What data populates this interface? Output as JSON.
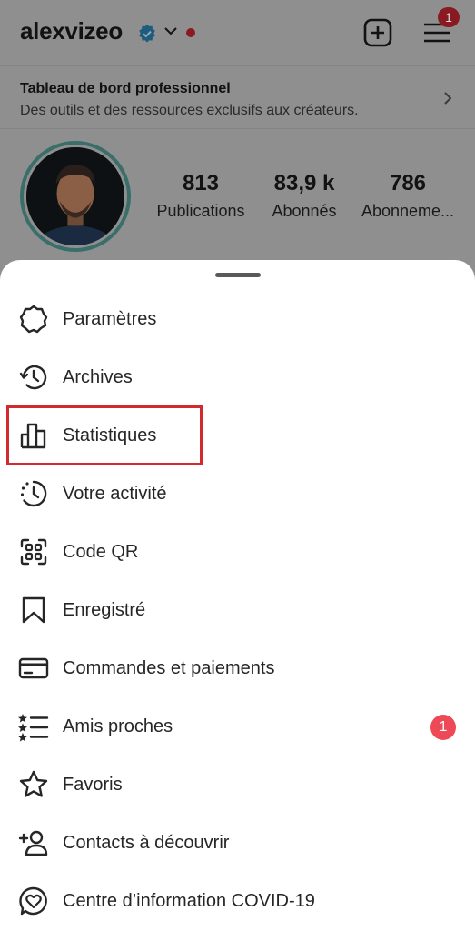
{
  "header": {
    "username": "alexvizeo",
    "menu_badge_count": "1"
  },
  "dashboard": {
    "title": "Tableau de bord professionnel",
    "subtitle": "Des outils et des ressources exclusifs aux créateurs."
  },
  "stats": [
    {
      "value": "813",
      "label": "Publications"
    },
    {
      "value": "83,9 k",
      "label": "Abonnés"
    },
    {
      "value": "786",
      "label": "Abonneme..."
    }
  ],
  "menu": {
    "items": [
      {
        "label": "Paramètres",
        "icon": "settings-gear-icon"
      },
      {
        "label": "Archives",
        "icon": "archive-history-icon"
      },
      {
        "label": "Statistiques",
        "icon": "bar-chart-icon"
      },
      {
        "label": "Votre activité",
        "icon": "activity-clock-icon"
      },
      {
        "label": "Code QR",
        "icon": "qr-code-icon"
      },
      {
        "label": "Enregistré",
        "icon": "bookmark-icon"
      },
      {
        "label": "Commandes et paiements",
        "icon": "credit-card-icon"
      },
      {
        "label": "Amis proches",
        "icon": "close-friends-list-icon",
        "badge": "1"
      },
      {
        "label": "Favoris",
        "icon": "star-icon"
      },
      {
        "label": "Contacts à découvrir",
        "icon": "add-person-icon"
      },
      {
        "label": "Centre d’information COVID-19",
        "icon": "covid-info-heart-icon"
      }
    ]
  },
  "colors": {
    "highlight_border": "#d42a2f",
    "badge": "#ed4956",
    "verified": "#0095f6"
  }
}
